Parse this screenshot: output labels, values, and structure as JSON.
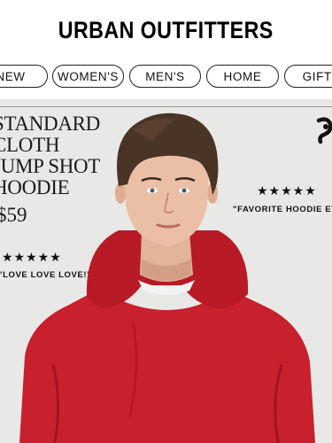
{
  "header": {
    "logo": "URBAN OUTFITTERS"
  },
  "nav": {
    "items": [
      {
        "label": "NEW"
      },
      {
        "label": "WOMEN'S"
      },
      {
        "label": "MEN'S"
      },
      {
        "label": "HOME"
      },
      {
        "label": "GIFTS"
      }
    ]
  },
  "hero": {
    "title_lines": [
      "STANDARD",
      "CLOTH",
      "JUMP SHOT",
      "HOODIE"
    ],
    "price": "$59",
    "rating_left": "★★★★★",
    "quote_left": "\"LOVE LOVE LOVE!\"",
    "rating_right": "★★★★★",
    "quote_right": "\"FAVORITE HOODIE EVER\"",
    "hoodie_color": "#c8202c",
    "background_color": "#e8e8e6"
  }
}
